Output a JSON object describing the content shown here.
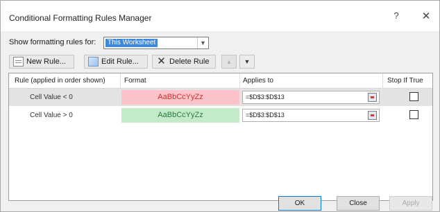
{
  "dialog": {
    "title": "Conditional Formatting Rules Manager",
    "help_symbol": "?",
    "close_symbol": "✕"
  },
  "scope": {
    "label": "Show formatting rules for:",
    "selected": "This Worksheet"
  },
  "toolbar": {
    "new_rule": "New Rule...",
    "edit_rule": "Edit Rule...",
    "delete_rule": "Delete Rule"
  },
  "columns": {
    "rule": "Rule (applied in order shown)",
    "format": "Format",
    "applies_to": "Applies to",
    "stop_if_true": "Stop If True"
  },
  "rules": [
    {
      "name": "Cell Value < 0",
      "format_sample": "AaBbCcYyZz",
      "fill": "#fcc4ca",
      "font_color": "#d0302b",
      "applies_to": "=$D$3:$D$13",
      "stop_if_true": false,
      "selected": true
    },
    {
      "name": "Cell Value > 0",
      "format_sample": "AaBbCcYyZz",
      "fill": "#c4ebc9",
      "font_color": "#2a7a37",
      "applies_to": "=$D$3:$D$13",
      "stop_if_true": false,
      "selected": false
    }
  ],
  "footer": {
    "ok": "OK",
    "close": "Close",
    "apply": "Apply"
  },
  "colors": {
    "accent": "#0078d7",
    "selection": "#3f87d8"
  }
}
